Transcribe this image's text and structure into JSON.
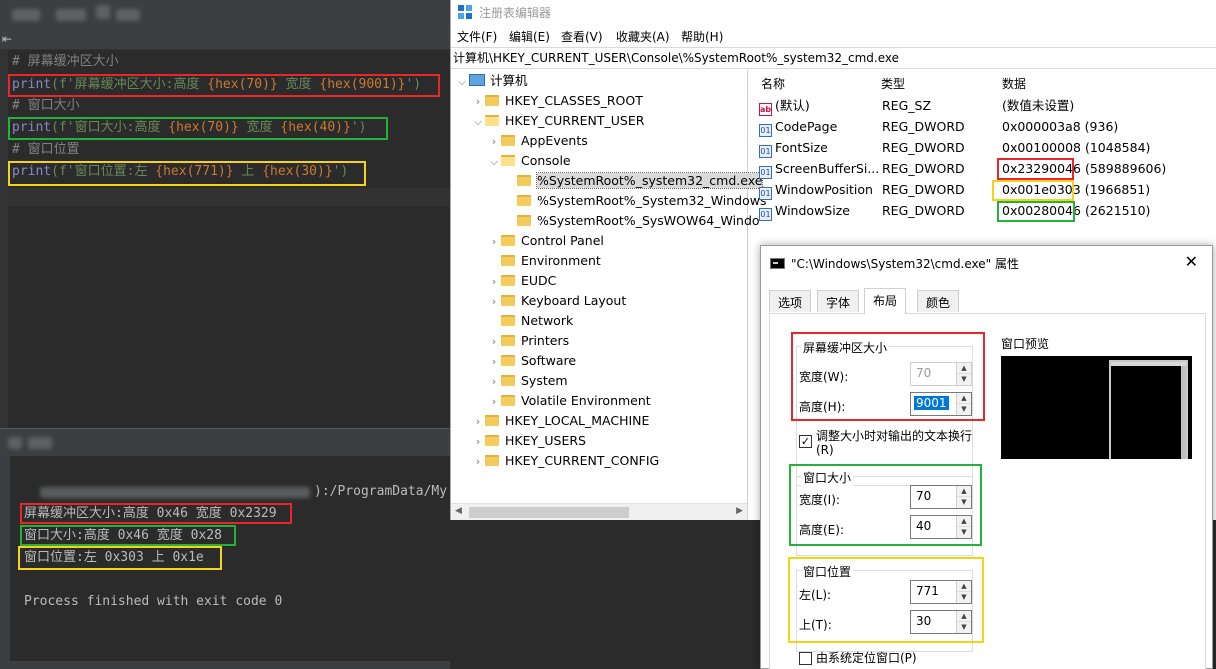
{
  "ide": {
    "code": {
      "comment_buffer": "# 屏幕缓冲区大小",
      "buffer": {
        "fn": "print",
        "pre": "(f'屏幕缓冲区大小:高度 ",
        "expr1": "{hex(70)}",
        "mid": " 宽度 ",
        "expr2": "{hex(9001)}",
        "post": "')"
      },
      "comment_window_size": "# 窗口大小",
      "window_size": {
        "fn": "print",
        "pre": "(f'窗口大小:高度 ",
        "expr1": "{hex(70)}",
        "mid": " 宽度 ",
        "expr2": "{hex(40)}",
        "post": "')"
      },
      "comment_window_pos": "# 窗口位置",
      "window_pos": {
        "fn": "print",
        "pre": "(f'窗口位置:左 ",
        "expr1": "{hex(771)}",
        "mid": " 上 ",
        "expr2": "{hex(30)}",
        "post": "')"
      }
    },
    "console": {
      "path_fragment": "):/ProgramData/My",
      "out1": "屏幕缓冲区大小:高度 0x46 宽度 0x2329",
      "out2": "窗口大小:高度 0x46 宽度 0x28",
      "out3": "窗口位置:左 0x303 上 0x1e",
      "exit": "Process finished with exit code 0"
    }
  },
  "regedit": {
    "title": "注册表编辑器",
    "menu": [
      "文件(F)",
      "编辑(E)",
      "查看(V)",
      "收藏夹(A)",
      "帮助(H)"
    ],
    "address": "计算机\\HKEY_CURRENT_USER\\Console\\%SystemRoot%_system32_cmd.exe",
    "tree": {
      "root": "计算机",
      "hkcr": "HKEY_CLASSES_ROOT",
      "hkcu": "HKEY_CURRENT_USER",
      "appevents": "AppEvents",
      "console": "Console",
      "cmd": "%SystemRoot%_system32_cmd.exe",
      "ps": "%SystemRoot%_System32_Windows",
      "wow": "%SystemRoot%_SysWOW64_Windo",
      "control_panel": "Control Panel",
      "environment": "Environment",
      "eudc": "EUDC",
      "keyboard": "Keyboard Layout",
      "network": "Network",
      "printers": "Printers",
      "software": "Software",
      "system": "System",
      "volatile": "Volatile Environment",
      "hklm": "HKEY_LOCAL_MACHINE",
      "hku": "HKEY_USERS",
      "hkcc": "HKEY_CURRENT_CONFIG"
    },
    "columns": {
      "name": "名称",
      "type": "类型",
      "data": "数据"
    },
    "values": [
      {
        "name": "(默认)",
        "type": "REG_SZ",
        "data": "(数值未设置)",
        "extra": ""
      },
      {
        "name": "CodePage",
        "type": "REG_DWORD",
        "data": "0x000003a8",
        "extra": "(936)"
      },
      {
        "name": "FontSize",
        "type": "REG_DWORD",
        "data": "0x00100008",
        "extra": "(1048584)"
      },
      {
        "name": "ScreenBufferSi...",
        "type": "REG_DWORD",
        "data": "0x23290046",
        "extra": "(589889606)"
      },
      {
        "name": "WindowPosition",
        "type": "REG_DWORD",
        "data": "0x001e0303",
        "extra": "(1966851)"
      },
      {
        "name": "WindowSize",
        "type": "REG_DWORD",
        "data": "0x00280046",
        "extra": "(2621510)"
      }
    ]
  },
  "dialog": {
    "title": "\"C:\\Windows\\System32\\cmd.exe\" 属性",
    "tabs": [
      "选项",
      "字体",
      "布局",
      "颜色"
    ],
    "buffer_group": "屏幕缓冲区大小",
    "buffer_width_label": "宽度(W):",
    "buffer_width": "70",
    "buffer_height_label": "高度(H):",
    "buffer_height": "9001",
    "wrap_label": "调整大小时对输出的文本换行",
    "wrap_label2": "(R)",
    "size_group": "窗口大小",
    "size_width_label": "宽度(I):",
    "size_width": "70",
    "size_height_label": "高度(E):",
    "size_height": "40",
    "pos_group": "窗口位置",
    "pos_left_label": "左(L):",
    "pos_left": "771",
    "pos_top_label": "上(T):",
    "pos_top": "30",
    "system_pos_label": "由系统定位窗口(P)",
    "preview_label": "窗口预览"
  }
}
